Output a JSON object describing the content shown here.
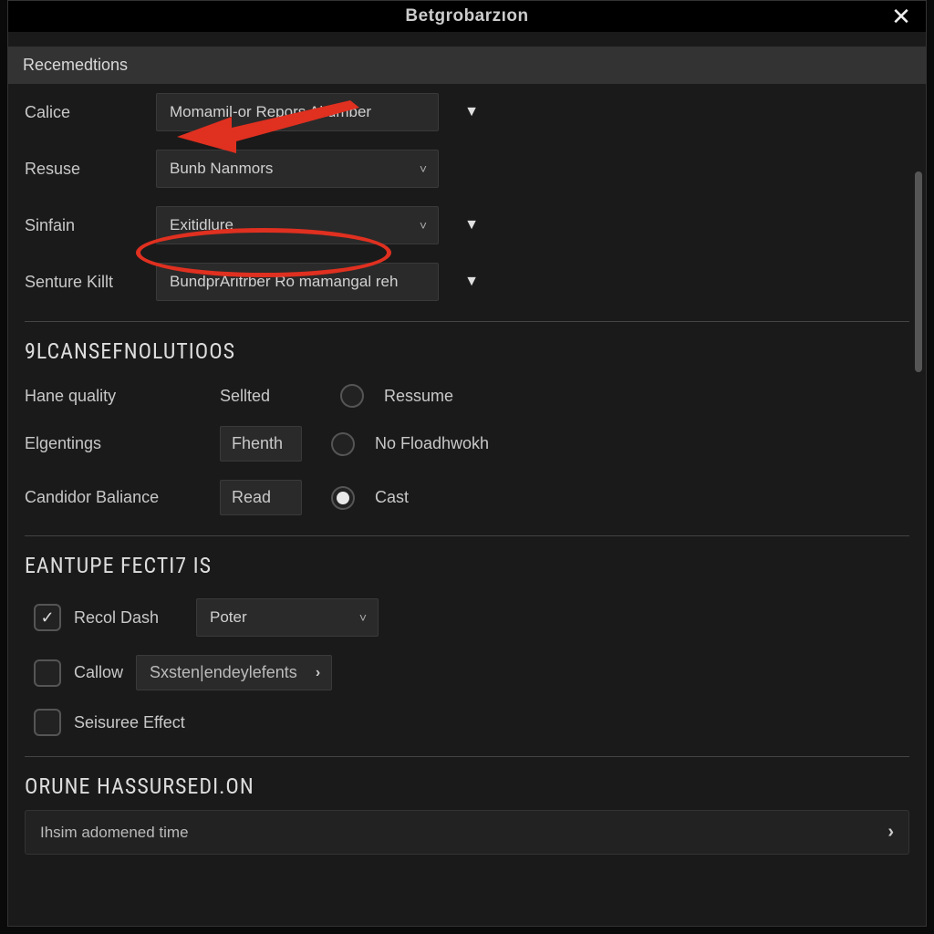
{
  "titlebar": {
    "title": "Betgrobarzıon"
  },
  "sections": {
    "recemedtions": {
      "header": "Recemedtions",
      "rows": [
        {
          "label": "Calice",
          "value": "Momamil-or Repors Altumber"
        },
        {
          "label": "Resuse",
          "value": "Bunb Nanmors"
        },
        {
          "label": "Sinfain",
          "value": "Exitidlure"
        },
        {
          "label": "Senture Killt",
          "value": "BundprAritrber Ro mamangal reh"
        }
      ]
    },
    "cansefnolutions": {
      "title": "9LCANSEFNOLUTIOOS",
      "options": [
        {
          "label": "Hane quality",
          "value": "Sellted",
          "radio_label": "Ressume",
          "radio_on": false
        },
        {
          "label": "Elgentings",
          "value": "Fhenth",
          "radio_label": "No Floadhwokh",
          "radio_on": false,
          "boxed": true
        },
        {
          "label": "Candidor Baliance",
          "value": "Read",
          "radio_label": "Cast",
          "radio_on": true,
          "boxed": true
        }
      ]
    },
    "eantupe": {
      "title": "EANTUPE FECTI7 IS",
      "items": [
        {
          "checked": true,
          "label": "Recol Dash",
          "select": "Poter"
        },
        {
          "checked": false,
          "label": "Callow",
          "inline": "Sxsten|endeylefents",
          "chev": true
        },
        {
          "checked": false,
          "label": "Seisuree Effect"
        }
      ]
    },
    "orune": {
      "title": "ORUNE HASSURSEDI.ON",
      "nav_label": "Ihsim adomened time"
    }
  },
  "annotations": {
    "arrow_color": "#e03020",
    "ellipse_color": "#e03020"
  }
}
